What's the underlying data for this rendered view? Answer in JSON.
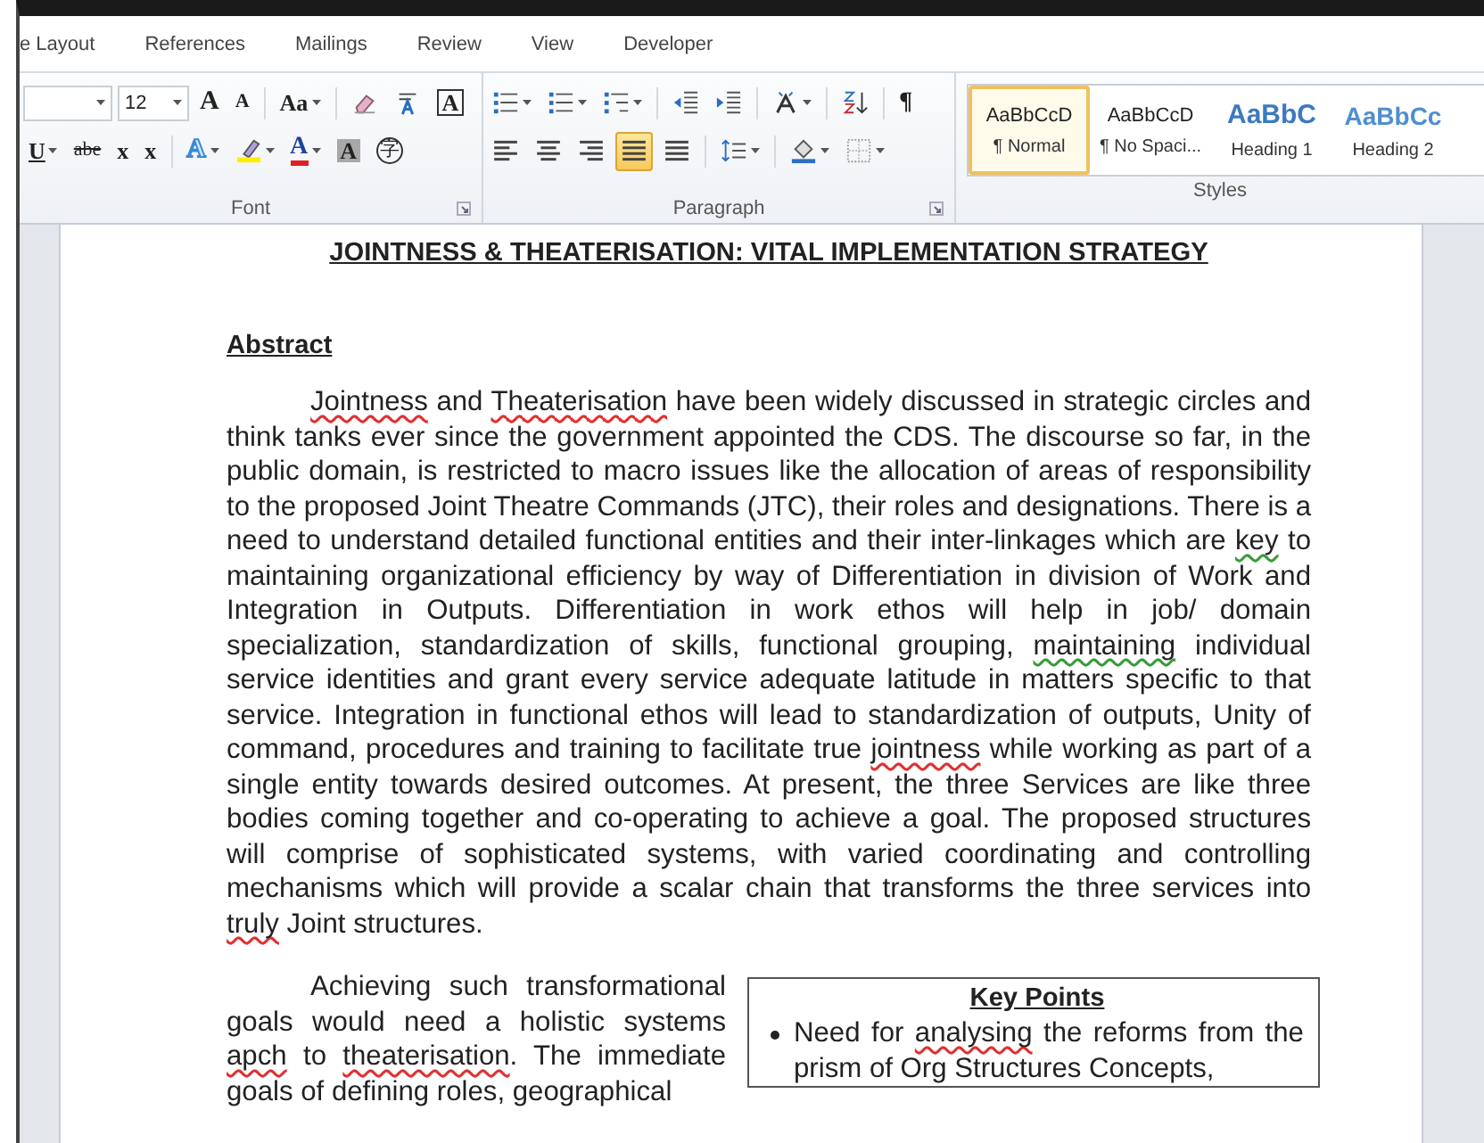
{
  "tabs": [
    {
      "label": "e Layout"
    },
    {
      "label": "References"
    },
    {
      "label": "Mailings"
    },
    {
      "label": "Review"
    },
    {
      "label": "View"
    },
    {
      "label": "Developer"
    }
  ],
  "font_group": {
    "label": "Font",
    "launcher": true,
    "font_size": "12",
    "row1": [
      {
        "kind": "grow",
        "text": "A",
        "menu": false
      },
      {
        "kind": "shrink",
        "text": "A",
        "menu": false
      },
      {
        "kind": "sep"
      },
      {
        "kind": "case",
        "text": "Aa",
        "menu": true
      },
      {
        "kind": "sep"
      },
      {
        "kind": "clear",
        "menu": false
      },
      {
        "kind": "phonetic",
        "menu": false
      },
      {
        "kind": "charborder",
        "text": "A",
        "menu": false
      }
    ],
    "row2": [
      {
        "kind": "underline",
        "text": "U",
        "menu": true
      },
      {
        "kind": "strike",
        "text": "abe",
        "menu": false
      },
      {
        "kind": "subscript",
        "text": "x",
        "menu": false
      },
      {
        "kind": "superscript",
        "text": "x",
        "menu": false
      },
      {
        "kind": "sep"
      },
      {
        "kind": "effects",
        "text": "A",
        "menu": true
      },
      {
        "kind": "highlight",
        "menu": true
      },
      {
        "kind": "color",
        "text": "A",
        "menu": true
      },
      {
        "kind": "shading",
        "text": "A",
        "menu": false
      },
      {
        "kind": "enclosed",
        "text": "字",
        "menu": false
      }
    ]
  },
  "paragraph_group": {
    "label": "Paragraph",
    "launcher": true,
    "row1": [
      {
        "kind": "bullets",
        "menu": true
      },
      {
        "kind": "numbering",
        "menu": true
      },
      {
        "kind": "multilevel",
        "menu": true
      },
      {
        "kind": "sep"
      },
      {
        "kind": "outdent",
        "menu": false
      },
      {
        "kind": "indent",
        "menu": false
      },
      {
        "kind": "sep"
      },
      {
        "kind": "asian",
        "menu": true
      },
      {
        "kind": "sep"
      },
      {
        "kind": "sort",
        "menu": false
      },
      {
        "kind": "sep"
      },
      {
        "kind": "pilcrow",
        "text": "¶",
        "menu": false
      }
    ],
    "row2": [
      {
        "kind": "align-left",
        "selected": false,
        "menu": false
      },
      {
        "kind": "align-center",
        "selected": false,
        "menu": false
      },
      {
        "kind": "align-right",
        "selected": false,
        "menu": false
      },
      {
        "kind": "justify",
        "selected": true,
        "menu": false
      },
      {
        "kind": "distributed",
        "selected": false,
        "menu": false
      },
      {
        "kind": "sep"
      },
      {
        "kind": "line-spacing",
        "menu": true
      },
      {
        "kind": "sep"
      },
      {
        "kind": "fill",
        "menu": true
      },
      {
        "kind": "borders",
        "menu": true
      }
    ]
  },
  "styles_group": {
    "label": "Styles",
    "launcher": false,
    "items": [
      {
        "kind": "body",
        "preview": "AaBbCcD",
        "name": "¶ Normal",
        "selected": true
      },
      {
        "kind": "body",
        "preview": "AaBbCcD",
        "name": "¶ No Spaci...",
        "selected": false
      },
      {
        "kind": "heading1",
        "preview": "AaBbC",
        "name": "Heading 1",
        "selected": false
      },
      {
        "kind": "heading2",
        "preview": "AaBbCc",
        "name": "Heading 2",
        "selected": false
      }
    ]
  },
  "document": {
    "title": "JOINTNESS & THEATERISATION: VITAL IMPLEMENTATION STRATEGY",
    "section_heading": "Abstract",
    "abstract": [
      {
        "text": "Jointness",
        "misspelled": true,
        "grammar_issue": false
      },
      {
        "text": " and ",
        "misspelled": false,
        "grammar_issue": false
      },
      {
        "text": "Theaterisation",
        "misspelled": true,
        "grammar_issue": false
      },
      {
        "text": " have been widely discussed in strategic circles and think tanks ever since the government appointed the CDS. The discourse so far, in the public domain, is restricted to macro issues like the allocation of areas of responsibility to the proposed Joint Theatre Commands (JTC), their roles and designations. There is a need to understand detailed functional entities and their inter-linkages which are ",
        "misspelled": false,
        "grammar_issue": false
      },
      {
        "text": "key",
        "misspelled": false,
        "grammar_issue": true
      },
      {
        "text": " to maintaining organizational efficiency by way of Differentiation in division of Work and Integration in Outputs. Differentiation in work ethos will help in job/ domain specialization, standardization of skills, functional grouping, ",
        "misspelled": false,
        "grammar_issue": false
      },
      {
        "text": "maintaining",
        "misspelled": false,
        "grammar_issue": true
      },
      {
        "text": " individual service identities and grant every service adequate latitude in matters specific to that service. Integration in functional ethos will lead to standardization of outputs, Unity of command, procedures and training to facilitate true ",
        "misspelled": false,
        "grammar_issue": false
      },
      {
        "text": "jointness",
        "misspelled": true,
        "grammar_issue": false
      },
      {
        "text": " while working as part of a single entity towards desired outcomes. At present, the three Services are like three bodies coming together and co-operating to achieve a goal. The proposed structures will comprise of sophisticated systems, with varied coordinating and controlling mechanisms which will provide a scalar chain that transforms the three services into ",
        "misspelled": false,
        "grammar_issue": false
      },
      {
        "text": "truly",
        "misspelled": true,
        "grammar_issue": false
      },
      {
        "text": " Joint structures.",
        "misspelled": false,
        "grammar_issue": false
      }
    ],
    "second_paragraph": [
      {
        "text": "Achieving such transformational goals would need a holistic systems ",
        "misspelled": false,
        "grammar_issue": false
      },
      {
        "text": "apch",
        "misspelled": true,
        "grammar_issue": false
      },
      {
        "text": " to ",
        "misspelled": false,
        "grammar_issue": false
      },
      {
        "text": "theaterisation",
        "misspelled": true,
        "grammar_issue": false
      },
      {
        "text": ". The immediate goals of defining roles, geographical",
        "misspelled": false,
        "grammar_issue": false
      }
    ],
    "key_points": {
      "title": "Key Points",
      "bullets": [
        [
          {
            "text": "Need for ",
            "misspelled": false,
            "grammar_issue": false
          },
          {
            "text": "analysing",
            "misspelled": true,
            "grammar_issue": false
          },
          {
            "text": " the reforms from the prism of Org Structures Concepts,",
            "misspelled": false,
            "grammar_issue": false
          }
        ]
      ]
    }
  }
}
